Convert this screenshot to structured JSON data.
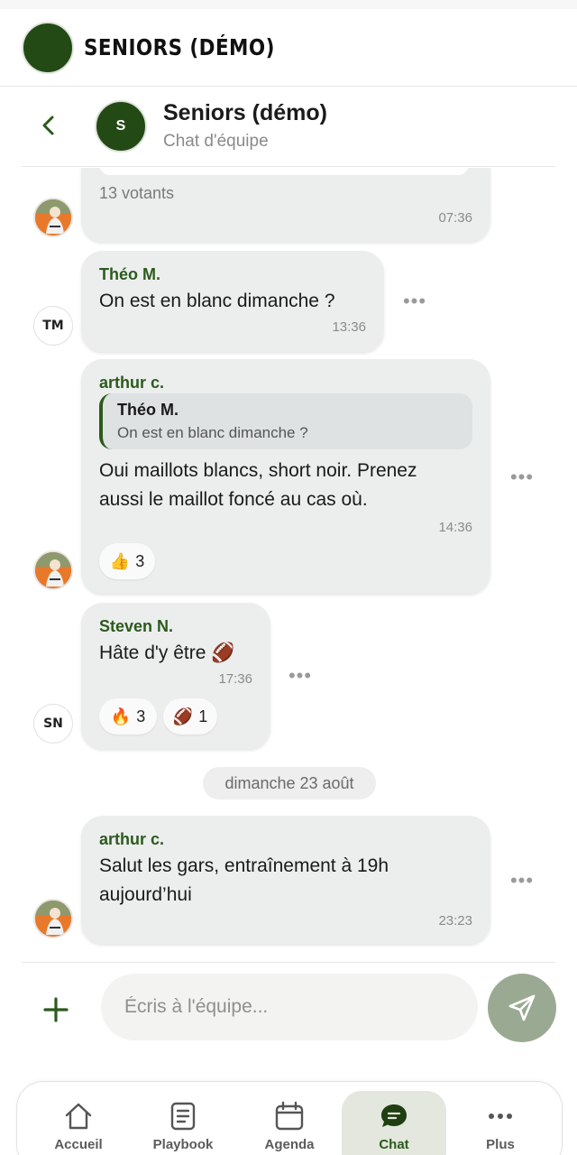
{
  "app": {
    "title": "SENIORS (DÉMO)"
  },
  "chat_header": {
    "avatar_initial": "S",
    "title": "Seniors (démo)",
    "subtitle": "Chat d'équipe"
  },
  "messages": [
    {
      "poll_voters": "13 votants",
      "time": "07:36"
    },
    {
      "sender": "Théo M.",
      "sender_initials": "TM",
      "text": "On est en blanc dimanche ?",
      "time": "13:36"
    },
    {
      "sender": "arthur c.",
      "reply_to": {
        "sender": "Théo M.",
        "text": "On est en blanc dimanche ?"
      },
      "text_lines": [
        "Oui maillots blancs, short noir. Prenez",
        "aussi le maillot foncé au cas où."
      ],
      "time": "14:36",
      "reactions": [
        {
          "emoji": "👍",
          "count": "3"
        }
      ]
    },
    {
      "sender": "Steven N.",
      "sender_initials": "SN",
      "text": "Hâte d'y être 🏈",
      "time": "17:36",
      "reactions": [
        {
          "emoji": "🔥",
          "count": "3"
        },
        {
          "emoji": "🏈",
          "count": "1"
        }
      ]
    },
    {
      "sender": "arthur c.",
      "text_lines": [
        "Salut les gars, entraînement à 19h",
        "aujourd’hui"
      ],
      "time": "23:23"
    }
  ],
  "date_separator": "dimanche 23 août",
  "composer": {
    "placeholder": "Écris à l'équipe..."
  },
  "tabs": [
    {
      "label": "Accueil",
      "icon": "home-icon"
    },
    {
      "label": "Playbook",
      "icon": "document-icon"
    },
    {
      "label": "Agenda",
      "icon": "calendar-icon"
    },
    {
      "label": "Chat",
      "icon": "chat-icon",
      "active": true
    },
    {
      "label": "Plus",
      "icon": "more-icon"
    }
  ],
  "colors": {
    "brand_green": "#2b5a1c",
    "logo_green": "#234a15",
    "send_button": "#9aaa92"
  }
}
